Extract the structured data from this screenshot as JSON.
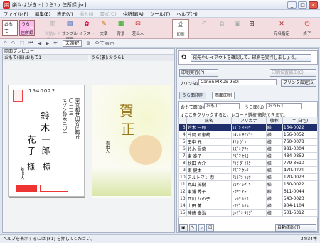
{
  "window": {
    "title": "楽々はがき - [うら1 / 住所録.jsr]"
  },
  "menu": [
    {
      "label": "ファイル(F)",
      "enabled": true
    },
    {
      "label": "編集(E)",
      "enabled": true
    },
    {
      "label": "表示(V)",
      "enabled": true
    },
    {
      "label": "挿入(I)",
      "enabled": false
    },
    {
      "label": "書式(O)",
      "enabled": false
    },
    {
      "label": "住所録(A)",
      "enabled": true
    },
    {
      "label": "ツール(T)",
      "enabled": true
    },
    {
      "label": "ヘルプ(H)",
      "enabled": true
    }
  ],
  "toolbar": {
    "omote_label": "おもて",
    "ura_label": "うら",
    "address_book_label": "住所録",
    "items": [
      "自動レイアウト",
      "サンプル選択",
      "イラスト",
      "文章",
      "背景",
      "差出人",
      "印刷",
      "",
      "",
      "",
      "",
      "",
      "宛名指定",
      "終了"
    ],
    "unselected": "未選択",
    "print_all": "全て表示"
  },
  "left_pane": {
    "header": "両面プレビュー",
    "front_label": "おもて(表):おもて1",
    "back_label": "うら(裏):おうら1",
    "postcode": "1540022",
    "address_lines": [
      "東京都世田谷区梅丘",
      "〇-二-三",
      "メゾン鈴木ニ〇一"
    ],
    "name_family": "鈴 木",
    "name_given_1": "一 郎",
    "name_given_2": "花 子",
    "honorific": "様",
    "sender": "差出人",
    "greeting_char_1": "賀",
    "greeting_char_2": "正"
  },
  "right_pane": {
    "hint": "宛先やレイアウトを確認して、印刷を実行しましょう。",
    "print_button": "印刷実行(P)",
    "print_position_button": "印刷位置補正(C)",
    "printer_label": "プリンタ名",
    "printer_name": "Canon PIXUS 960i",
    "printer_setup": "プリンタ設定(S)",
    "tab_ura": "うら面印刷",
    "tab_both": "両面印刷",
    "omote_select_label": "おもて面(D)",
    "omote_select": "おもて1",
    "ura_select_label": "うら面(U)",
    "ura_select": "おうら1",
    "instruction": "↓ここをクリックすると、レコード選択/解除できます。",
    "columns": [
      "",
      "氏名",
      "フリガナ",
      "敬称",
      "〒(自宅)"
    ],
    "rows": [
      {
        "no": "3",
        "name": "鈴木 一郎",
        "kana": "ｽｽﾞｷ ｲﾁﾛｳ",
        "hon": "様",
        "zip": "154-0022"
      },
      {
        "no": "4",
        "name": "片岡 知恵蔵",
        "kana": "ｶﾀｵｶ ﾁｴｿﾞｳ",
        "hon": "様",
        "zip": "156-0052"
      },
      {
        "no": "5",
        "name": "田中 元",
        "kana": "ﾀﾅｶ ｹﾞﾝ",
        "hon": "様",
        "zip": "760-0078"
      },
      {
        "no": "6",
        "name": "鈴木 吾茶",
        "kana": "ｽｽﾞｷ ｱﾁｬ",
        "hon": "様",
        "zip": "981-0304"
      },
      {
        "no": "7",
        "name": "東 泰子",
        "kana": "ｱｽﾞﾏ ﾔｽｺ",
        "hon": "様",
        "zip": "484-0852"
      },
      {
        "no": "8",
        "name": "秋田 大介",
        "kana": "ｱｷﾀ ﾀﾞｲｽｹ",
        "hon": "様",
        "zip": "779-3610"
      },
      {
        "no": "9",
        "name": "東 健太",
        "kana": "ｱｽﾞﾏ ｹﾝﾀ",
        "hon": "様",
        "zip": "470-0221"
      },
      {
        "no": "10",
        "name": "アルトマン 恭",
        "kana": "ｱﾙﾄﾏﾝ ｷｮｳ",
        "hon": "様",
        "zip": "120-0023"
      },
      {
        "no": "11",
        "name": "丸山 茂樹",
        "kana": "ﾏﾙﾔﾏ ｼｹﾞｷ",
        "hon": "様",
        "zip": "150-0022"
      },
      {
        "no": "12",
        "name": "東浦 秀子",
        "kana": "ﾄｳｳﾗ ﾋﾃﾞｺ",
        "hon": "様",
        "zip": "611-0044"
      },
      {
        "no": "13",
        "name": "西川 かの子",
        "kana": "ﾆｼｶﾜ ｶﾉｺ",
        "hon": "様",
        "zip": "543-0023"
      },
      {
        "no": "14",
        "name": "山田 薫",
        "kana": "ﾔﾏﾀﾞ ｶｵﾙ",
        "hon": "様",
        "zip": "904-1104"
      },
      {
        "no": "15",
        "name": "神崎 泰治",
        "kana": "ｶﾝｻﾞｷ ﾀｲｼﾞ",
        "hon": "様",
        "zip": "501-6312"
      }
    ],
    "auto_confirm": "自動確認(T)"
  },
  "status": {
    "help": "ヘルプを表示するには [F1] を押してください。",
    "count": "34/34件"
  }
}
